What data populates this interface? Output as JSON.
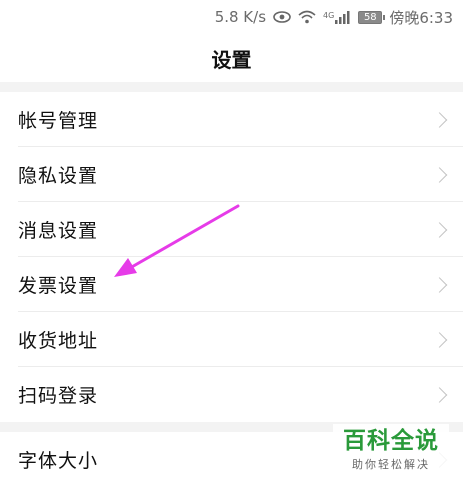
{
  "status_bar": {
    "speed": "5.8 K/s",
    "network": "4G",
    "battery": "58",
    "time": "傍晚6:33"
  },
  "header": {
    "title": "设置"
  },
  "settings": {
    "group1": [
      {
        "label": "帐号管理"
      },
      {
        "label": "隐私设置"
      },
      {
        "label": "消息设置"
      },
      {
        "label": "发票设置"
      },
      {
        "label": "收货地址"
      },
      {
        "label": "扫码登录"
      }
    ],
    "group2": [
      {
        "label": "字体大小"
      }
    ]
  },
  "watermark": {
    "title": "百科全说",
    "subtitle": "助你轻松解决"
  },
  "colors": {
    "annotation_arrow": "#e63be8",
    "watermark_green": "#2a9a3a",
    "section_gap": "#f3f3f3"
  }
}
